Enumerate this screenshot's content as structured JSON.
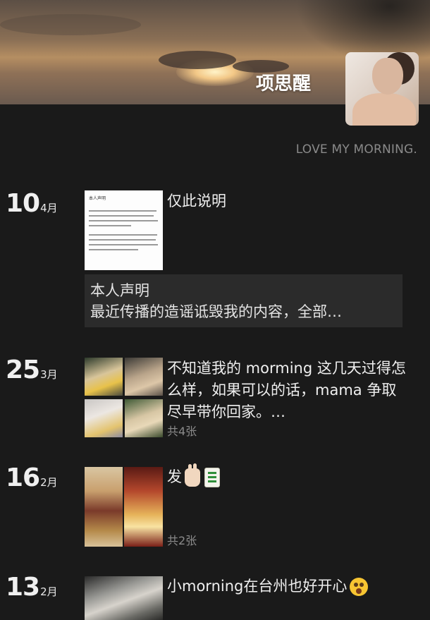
{
  "profile": {
    "username": "项思醒",
    "signature": "LOVE MY MORNING."
  },
  "posts": [
    {
      "day": "10",
      "month": "4月",
      "text": "仅此说明",
      "link_card": {
        "line1": "本人声明",
        "line2": "最近传播的造谣诋毁我的内容，全部…"
      },
      "document_heading": "本人声明"
    },
    {
      "day": "25",
      "month": "3月",
      "text": "不知道我的 morming 这几天过得怎么样，如果可以的话，mama 争取尽早带你回家。…",
      "count": "共4张"
    },
    {
      "day": "16",
      "month": "2月",
      "text": "发",
      "emojis": [
        "victory-hand-icon",
        "mahjong-fa-tile-icon"
      ],
      "count": "共2张"
    },
    {
      "day": "13",
      "month": "2月",
      "text": "小morning在台州也好开心",
      "emojis": [
        "astonished-face-icon"
      ]
    }
  ],
  "colors": {
    "background": "#1a1a1a",
    "link_card_bg": "#2b2b2b",
    "muted_text": "#8b8b8b"
  }
}
